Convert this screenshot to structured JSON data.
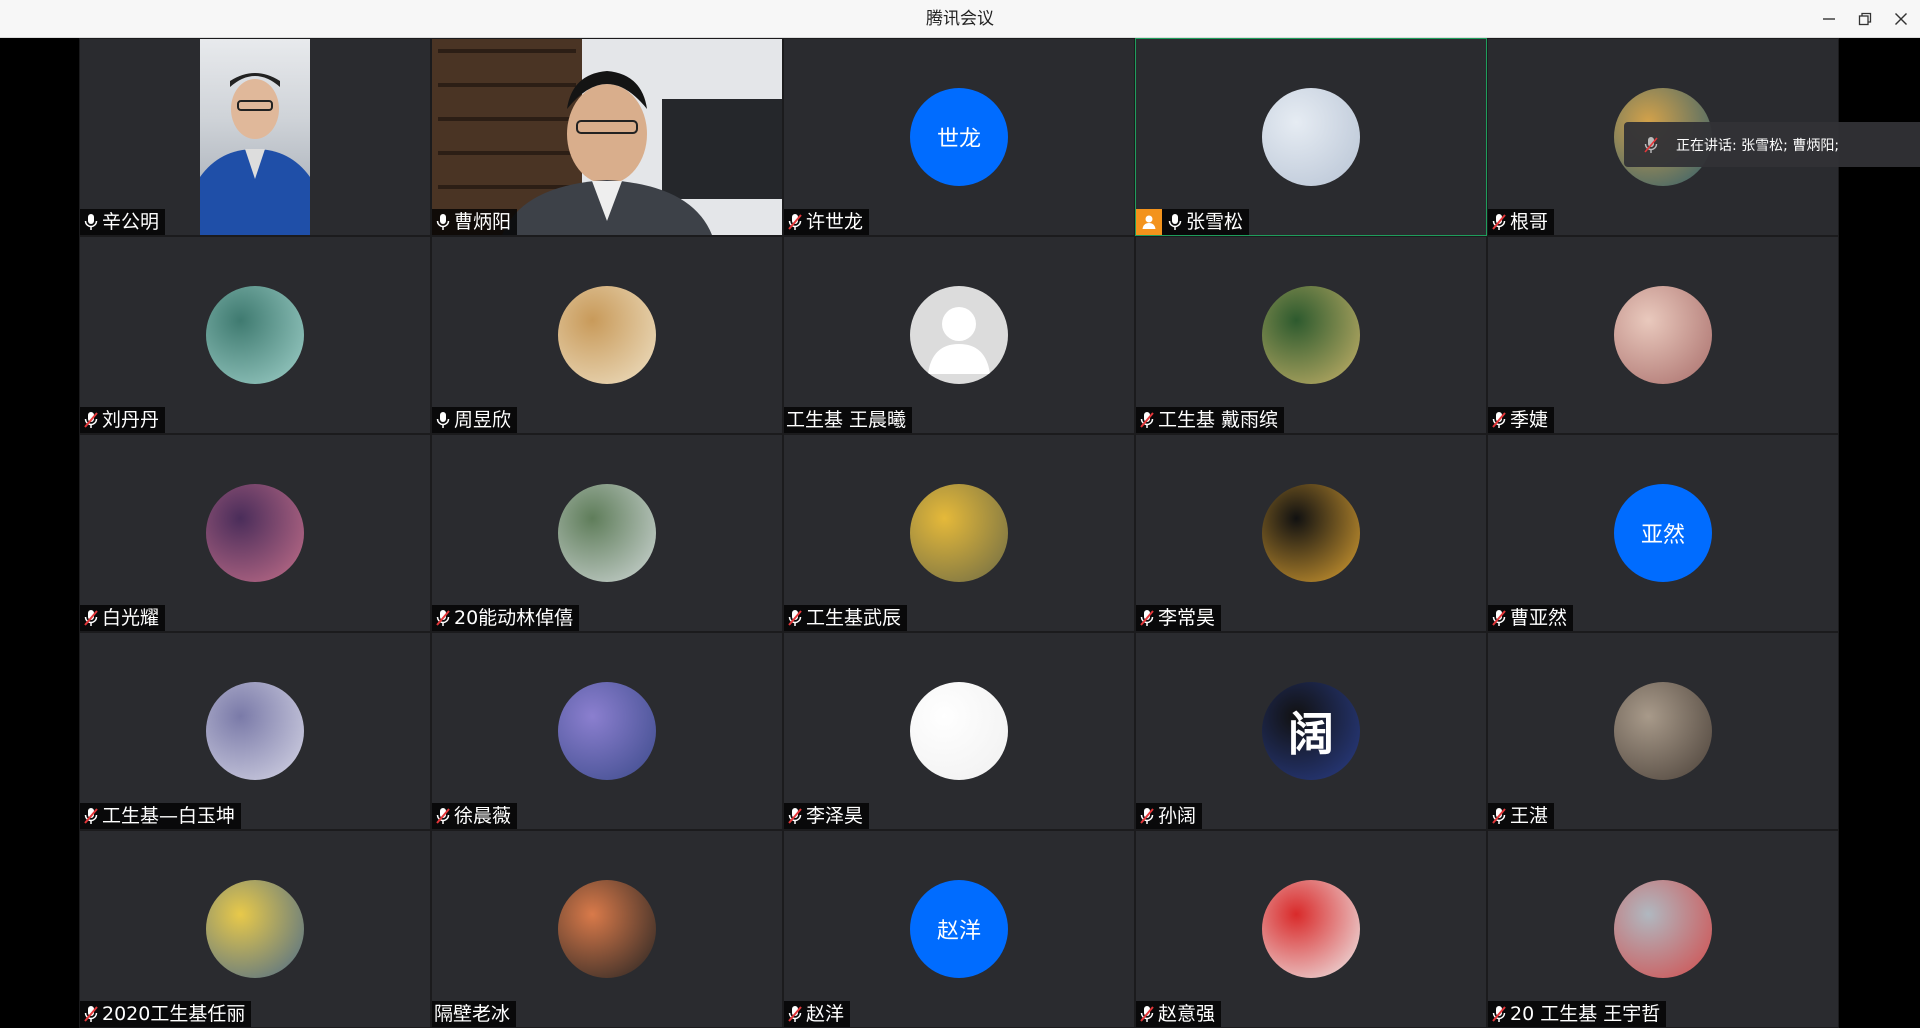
{
  "window": {
    "title": "腾讯会议",
    "controls": [
      "minimize-icon",
      "restore-icon",
      "close-icon"
    ]
  },
  "speaking_toast": {
    "text": "正在讲话: 张雪松; 曹炳阳;"
  },
  "colors": {
    "tile_bg": "#2a2b2f",
    "avatar_blue": "#006cff",
    "muted_mic": "#e4373a",
    "host_badge": "#f3931c",
    "active_border": "#1f9d5c"
  },
  "participants": [
    {
      "name": "辛公明",
      "mic": "on",
      "media": "video"
    },
    {
      "name": "曹炳阳",
      "mic": "on",
      "media": "video"
    },
    {
      "name": "许世龙",
      "mic": "muted",
      "media": "initials",
      "initials": "世龙"
    },
    {
      "name": "张雪松",
      "mic": "on",
      "media": "avatar",
      "host": true,
      "active": true
    },
    {
      "name": "根哥",
      "mic": "muted",
      "media": "avatar"
    },
    {
      "name": "刘丹丹",
      "mic": "muted",
      "media": "avatar"
    },
    {
      "name": "周昱欣",
      "mic": "on",
      "media": "avatar"
    },
    {
      "name": "工生基 王晨曦",
      "mic": "none",
      "media": "default-avatar"
    },
    {
      "name": "工生基 戴雨缤",
      "mic": "muted",
      "media": "avatar"
    },
    {
      "name": "季婕",
      "mic": "muted",
      "media": "avatar"
    },
    {
      "name": "白光耀",
      "mic": "muted",
      "media": "avatar"
    },
    {
      "name": "20能动林倬僖",
      "mic": "muted",
      "media": "avatar"
    },
    {
      "name": "工生基武辰",
      "mic": "muted",
      "media": "avatar"
    },
    {
      "name": "李常昊",
      "mic": "muted",
      "media": "avatar"
    },
    {
      "name": "曹亚然",
      "mic": "muted",
      "media": "initials",
      "initials": "亚然"
    },
    {
      "name": "工生基—白玉坤",
      "mic": "muted",
      "media": "avatar"
    },
    {
      "name": "徐晨薇",
      "mic": "muted",
      "media": "avatar"
    },
    {
      "name": "李泽昊",
      "mic": "muted",
      "media": "avatar"
    },
    {
      "name": "孙阔",
      "mic": "muted",
      "media": "avatar",
      "avatar_char": "阔"
    },
    {
      "name": "王湛",
      "mic": "muted",
      "media": "avatar"
    },
    {
      "name": "2020工生基任丽",
      "mic": "muted",
      "media": "avatar"
    },
    {
      "name": "隔壁老冰",
      "mic": "none",
      "media": "avatar"
    },
    {
      "name": "赵洋",
      "mic": "muted",
      "media": "initials",
      "initials": "赵洋"
    },
    {
      "name": "赵意强",
      "mic": "muted",
      "media": "avatar"
    },
    {
      "name": "20 工生基 王宇哲",
      "mic": "muted",
      "media": "avatar"
    }
  ]
}
